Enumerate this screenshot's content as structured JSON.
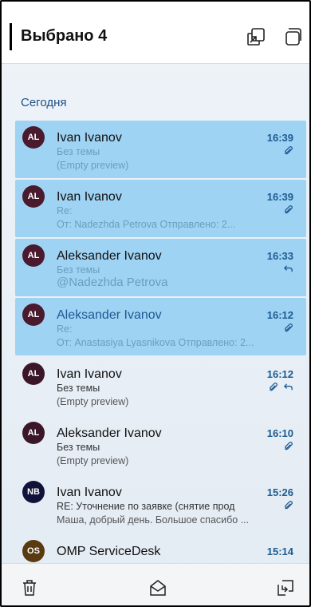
{
  "header": {
    "title": "Выбрано 4",
    "icons": [
      "pip-icon",
      "copy-icon"
    ]
  },
  "section": {
    "title": "Сегодня"
  },
  "emails": [
    {
      "avatar": "AL",
      "avatar_color": "#4a1a2e",
      "sender": "Ivan Ivanov",
      "time": "16:39",
      "subject": "Без темы",
      "preview": "(Empty preview)",
      "selected": true,
      "icons": [
        "paperclip-icon"
      ]
    },
    {
      "avatar": "AL",
      "avatar_color": "#4a1a2e",
      "sender": "Ivan Ivanov",
      "time": "16:39",
      "subject": "Re:",
      "preview": "От: Nadezhda Petrova  Отправлено: 2...",
      "selected": true,
      "icons": [
        "paperclip-icon"
      ]
    },
    {
      "avatar": "AL",
      "avatar_color": "#4a1a2e",
      "sender": "Aleksander Ivanov",
      "time": "16:33",
      "subject": "Без темы",
      "preview": "@Nadezhda Petrova",
      "selected": true,
      "icons": [
        "reply-icon"
      ]
    },
    {
      "avatar": "AL",
      "avatar_color": "#4a1a2e",
      "sender": "Aleksander Ivanov",
      "time": "16:12",
      "subject": "Re:",
      "preview": "От: Anastasiya Lyasnikova Отправлено: 2...",
      "selected": true,
      "icons": [
        "paperclip-icon"
      ]
    },
    {
      "avatar": "AL",
      "avatar_color": "#3b1629",
      "sender": "Ivan Ivanov",
      "time": "16:12",
      "subject": "Без темы",
      "preview": "(Empty preview)",
      "selected": false,
      "icons": [
        "paperclip-icon",
        "reply-icon"
      ]
    },
    {
      "avatar": "AL",
      "avatar_color": "#3b1629",
      "sender": "Aleksander Ivanov",
      "time": "16:10",
      "subject": "Без темы",
      "preview": "(Empty preview)",
      "selected": false,
      "icons": [
        "paperclip-icon"
      ]
    },
    {
      "avatar": "NB",
      "avatar_color": "#10123a",
      "sender": "Ivan Ivanov",
      "time": "15:26",
      "subject": "RE: Уточнение по заявке (снятие прод",
      "preview": "Маша, добрый день. Большое спасибо ...",
      "selected": false,
      "icons": [
        "paperclip-icon"
      ]
    },
    {
      "avatar": "OS",
      "avatar_color": "#5a3a10",
      "sender": "OMP ServiceDesk",
      "time": "15:14",
      "subject": "",
      "preview": "",
      "selected": false,
      "icons": []
    }
  ],
  "toolbar": {
    "icons": [
      "trash-icon",
      "envelope-open-icon",
      "move-to-folder-icon"
    ]
  },
  "colors": {
    "selected_bg": "#9fd3f3",
    "accent": "#1c5b93"
  }
}
